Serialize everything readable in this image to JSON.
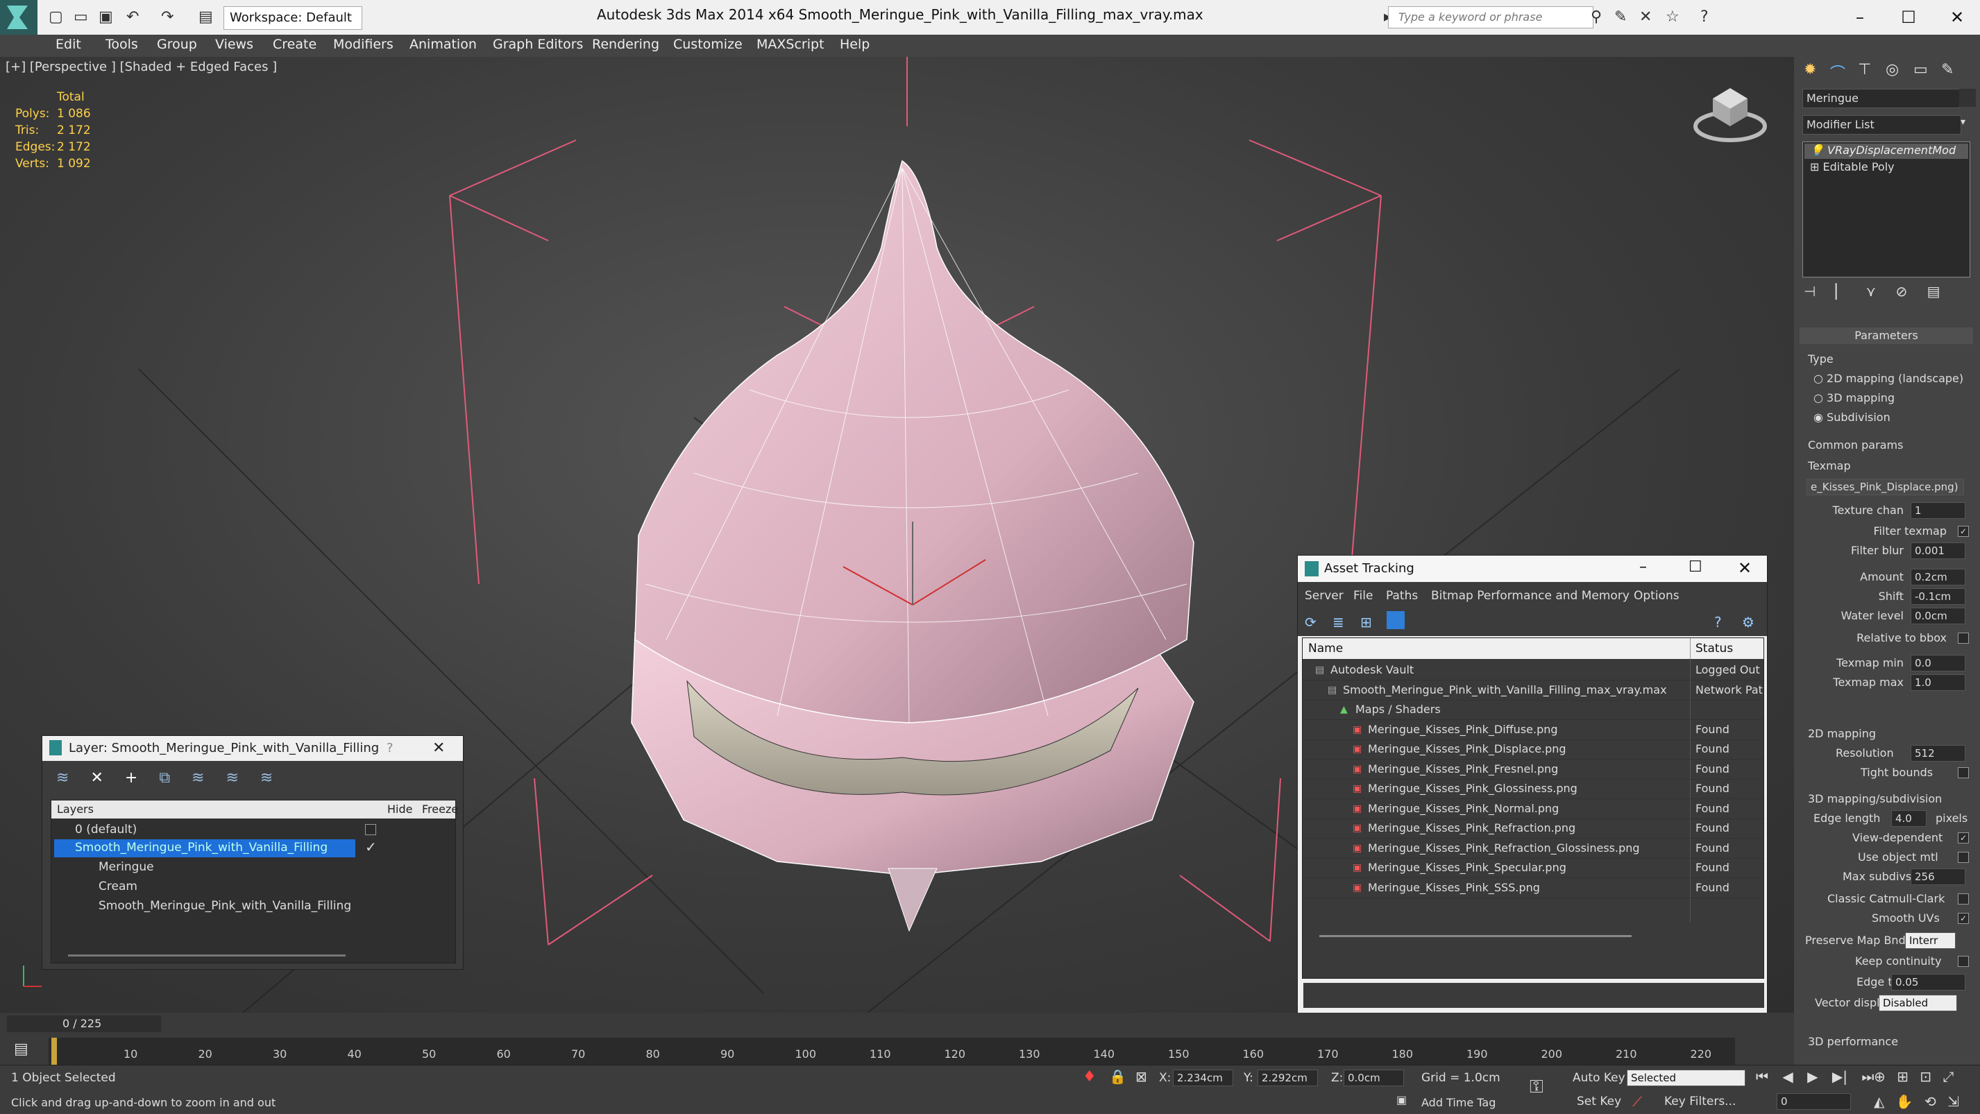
{
  "window": {
    "title": "Autodesk 3ds Max  2014 x64     Smooth_Meringue_Pink_with_Vanilla_Filling_max_vray.max",
    "workspace": "Workspace: Default",
    "search_placeholder": "Type a keyword or phrase"
  },
  "menu": [
    "Edit",
    "Tools",
    "Group",
    "Views",
    "Create",
    "Modifiers",
    "Animation",
    "Graph Editors",
    "Rendering",
    "Customize",
    "MAXScript",
    "Help"
  ],
  "viewport": {
    "label": "[+] [Perspective ] [Shaded + Edged Faces ]",
    "stats": {
      "header": "Total",
      "rows": [
        {
          "label": "Polys:",
          "value": "1 086"
        },
        {
          "label": "Tris:",
          "value": "2 172"
        },
        {
          "label": "Edges:",
          "value": "2 172"
        },
        {
          "label": "Verts:",
          "value": "1 092"
        }
      ]
    }
  },
  "layer_panel": {
    "title": "Layer: Smooth_Meringue_Pink_with_Vanilla_Filling",
    "help": "?",
    "columns": [
      "Layers",
      "Hide",
      "Freeze"
    ],
    "rows": [
      {
        "name": "0 (default)",
        "indent": 0
      },
      {
        "name": "Smooth_Meringue_Pink_with_Vanilla_Filling",
        "indent": 0,
        "selected": true
      },
      {
        "name": "Meringue",
        "indent": 1
      },
      {
        "name": "Cream",
        "indent": 1
      },
      {
        "name": "Smooth_Meringue_Pink_with_Vanilla_Filling",
        "indent": 1
      }
    ]
  },
  "asset_tracking": {
    "title": "Asset Tracking",
    "menu": [
      "Server",
      "File",
      "Paths",
      "Bitmap Performance and Memory",
      "Options"
    ],
    "columns": [
      "Name",
      "Status"
    ],
    "rows": [
      {
        "name": "Autodesk Vault",
        "status": "Logged Out",
        "indent": 1
      },
      {
        "name": "Smooth_Meringue_Pink_with_Vanilla_Filling_max_vray.max",
        "status": "Network Pat",
        "indent": 2
      },
      {
        "name": "Maps / Shaders",
        "status": "",
        "indent": 3
      },
      {
        "name": "Meringue_Kisses_Pink_Diffuse.png",
        "status": "Found",
        "indent": 4
      },
      {
        "name": "Meringue_Kisses_Pink_Displace.png",
        "status": "Found",
        "indent": 4
      },
      {
        "name": "Meringue_Kisses_Pink_Fresnel.png",
        "status": "Found",
        "indent": 4
      },
      {
        "name": "Meringue_Kisses_Pink_Glossiness.png",
        "status": "Found",
        "indent": 4
      },
      {
        "name": "Meringue_Kisses_Pink_Normal.png",
        "status": "Found",
        "indent": 4
      },
      {
        "name": "Meringue_Kisses_Pink_Refraction.png",
        "status": "Found",
        "indent": 4
      },
      {
        "name": "Meringue_Kisses_Pink_Refraction_Glossiness.png",
        "status": "Found",
        "indent": 4
      },
      {
        "name": "Meringue_Kisses_Pink_Specular.png",
        "status": "Found",
        "indent": 4
      },
      {
        "name": "Meringue_Kisses_Pink_SSS.png",
        "status": "Found",
        "indent": 4
      }
    ]
  },
  "command_panel": {
    "object_name": "Meringue",
    "modifier_list": "Modifier List",
    "stack": [
      "VRayDisplacementMod",
      "Editable Poly"
    ],
    "rollout_title": "Parameters",
    "type_label": "Type",
    "type_options": [
      "2D mapping (landscape)",
      "3D mapping",
      "Subdivision"
    ],
    "common_params": "Common params",
    "texmap_label": "Texmap",
    "texmap_value": "e_Kisses_Pink_Displace.png)",
    "params": [
      {
        "label": "Texture chan",
        "value": "1"
      },
      {
        "label": "Filter texmap",
        "check": true
      },
      {
        "label": "Filter blur",
        "value": "0.001"
      },
      {
        "label": "Amount",
        "value": "0.2cm"
      },
      {
        "label": "Shift",
        "value": "-0.1cm"
      },
      {
        "label": "Water level",
        "value": "0.0cm"
      },
      {
        "label": "Relative to bbox",
        "check": false
      },
      {
        "label": "Texmap min",
        "value": "0.0"
      },
      {
        "label": "Texmap max",
        "value": "1.0"
      }
    ],
    "mapping_2d": "2D mapping",
    "resolution": {
      "label": "Resolution",
      "value": "512"
    },
    "tight_bounds": "Tight bounds",
    "mapping_3d": "3D mapping/subdivision",
    "edge_length": {
      "label": "Edge length",
      "value": "4.0",
      "unit": "pixels"
    },
    "checks_3d": [
      {
        "label": "View-dependent",
        "check": true
      },
      {
        "label": "Use object mtl",
        "check": false
      }
    ],
    "max_subdivs": {
      "label": "Max subdivs",
      "value": "256"
    },
    "checks_3d_b": [
      {
        "label": "Classic Catmull-Clark",
        "check": false
      },
      {
        "label": "Smooth UVs",
        "check": true
      }
    ],
    "preserve_map": {
      "label": "Preserve Map Bnd",
      "value": "Interr"
    },
    "keep_continuity": "Keep continuity",
    "edge_thresh": {
      "label": "Edge thresh",
      "value": "0.05"
    },
    "vector_displ": {
      "label": "Vector displ",
      "value": "Disabled"
    },
    "performance": "3D performance"
  },
  "timeline": {
    "frame": "0 / 225",
    "ticks": [
      "10",
      "20",
      "30",
      "40",
      "50",
      "60",
      "70",
      "80",
      "90",
      "100",
      "110",
      "120",
      "130",
      "140",
      "150",
      "160",
      "170",
      "180",
      "190",
      "200",
      "210",
      "220"
    ]
  },
  "status": {
    "selected": "1 Object Selected",
    "hint": "Click and drag up-and-down to zoom in and out",
    "x_label": "X:",
    "x": "2.234cm",
    "y_label": "Y:",
    "y": "2.292cm",
    "z_label": "Z:",
    "z": "0.0cm",
    "grid": "Grid = 1.0cm",
    "add_time_tag": "Add Time Tag",
    "auto_key": "Auto Key",
    "auto_key_value": "Selected",
    "set_key": "Set Key",
    "key_filters": "Key Filters...",
    "frame_field": "0"
  }
}
